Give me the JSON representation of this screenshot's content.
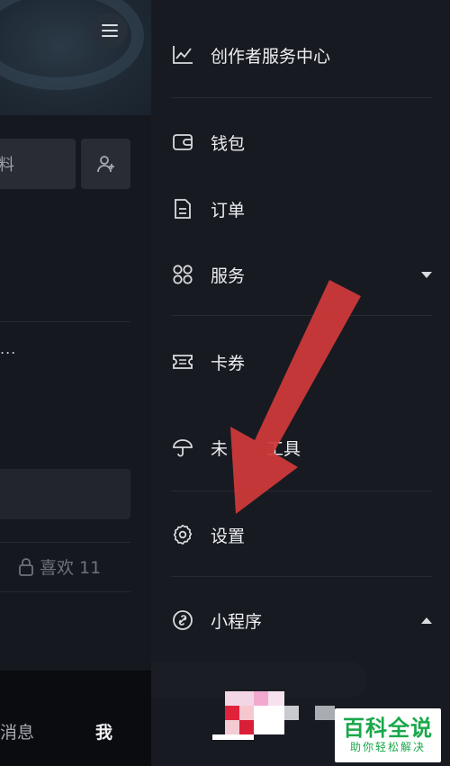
{
  "left": {
    "edit_label": "料",
    "ellipsis": "...",
    "likes_label": "喜欢 11",
    "nav_messages": "消息",
    "nav_me": "我"
  },
  "drawer": {
    "items": [
      {
        "label": "创作者服务中心",
        "icon": "chart-icon"
      },
      {
        "label": "钱包",
        "icon": "wallet-icon"
      },
      {
        "label": "订单",
        "icon": "order-icon"
      },
      {
        "label": "服务",
        "icon": "grid-icon",
        "expand": "collapsed"
      },
      {
        "label": "卡券",
        "icon": "ticket-icon"
      },
      {
        "label": "未",
        "icon": "umbrella-icon"
      },
      {
        "label": "工具",
        "icon": ""
      },
      {
        "label": "设置",
        "icon": "gear-icon"
      },
      {
        "label": "小程序",
        "icon": "link-icon",
        "expand": "expanded"
      }
    ]
  },
  "watermark": {
    "title": "百科全说",
    "subtitle": "助你轻松解决"
  },
  "colors": {
    "drawer_bg": "#181a22",
    "arrow": "#d23a3a",
    "watermark_green": "#1aa84a"
  }
}
